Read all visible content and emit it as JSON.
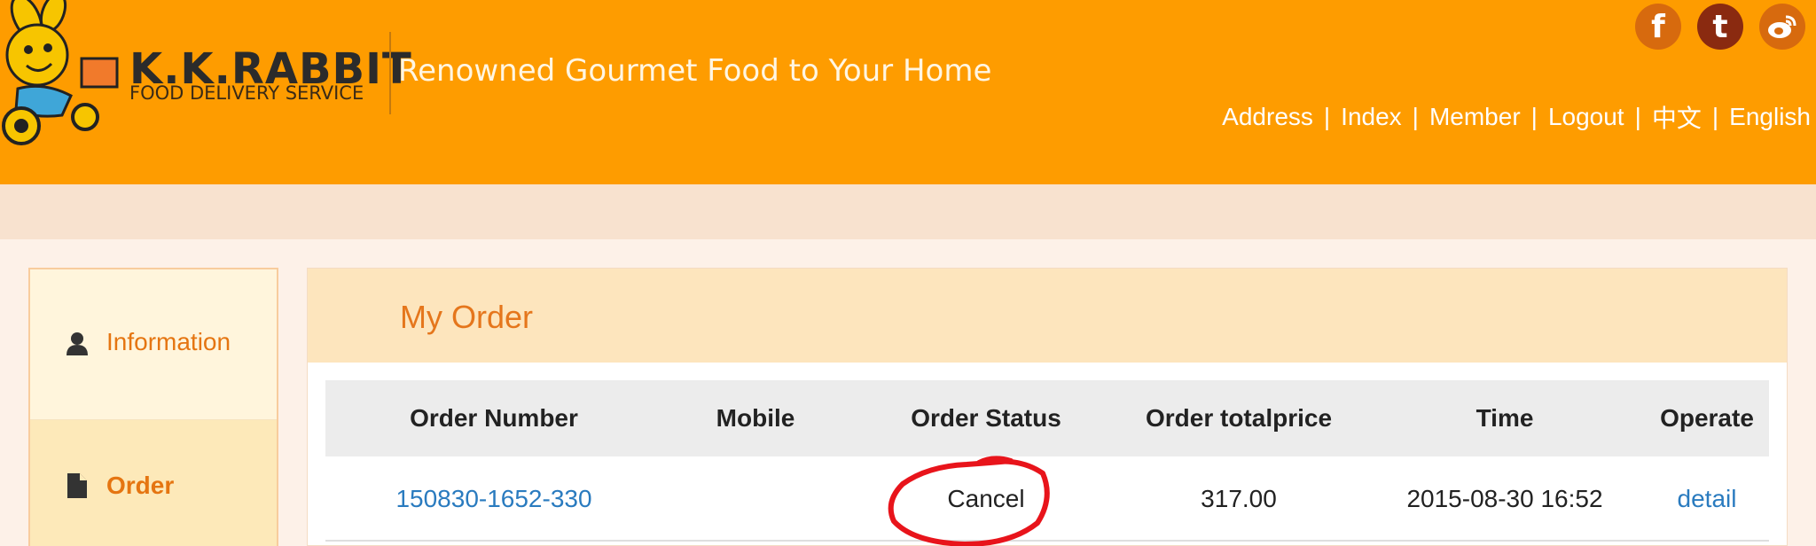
{
  "header": {
    "brand_name": "K.K.RABBIT",
    "brand_sub": "FOOD DELIVERY SERVICE",
    "tagline": "Renowned Gourmet Food to Your Home",
    "social": [
      {
        "name": "facebook-icon",
        "glyph": "f"
      },
      {
        "name": "tumblr-icon",
        "glyph": "t"
      },
      {
        "name": "weibo-icon",
        "glyph": "微"
      }
    ],
    "nav": [
      {
        "label": "Address"
      },
      {
        "label": "Index"
      },
      {
        "label": "Member"
      },
      {
        "label": "Logout"
      },
      {
        "label": "中文"
      },
      {
        "label": "English"
      }
    ],
    "separator": "|"
  },
  "sidebar": {
    "items": [
      {
        "label": "Information",
        "icon": "user-icon"
      },
      {
        "label": "Order",
        "icon": "document-icon"
      }
    ]
  },
  "main": {
    "title": "My Order",
    "table": {
      "columns": [
        "Order Number",
        "Mobile",
        "Order Status",
        "Order totalprice",
        "Time",
        "Operate"
      ],
      "rows": [
        {
          "order_number": "150830-1652-330",
          "mobile": "",
          "status": "Cancel",
          "totalprice": "317.00",
          "time": "2015-08-30 16:52",
          "operate": "detail"
        }
      ]
    }
  },
  "colors": {
    "header_bg": "#fe9c00",
    "accent_orange": "#e5761c",
    "link_blue": "#2a7bbf",
    "annotation_red": "#e8141b"
  }
}
